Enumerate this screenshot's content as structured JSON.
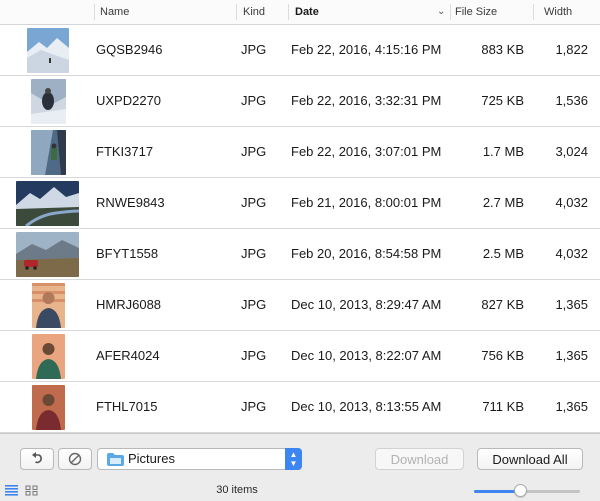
{
  "header": {
    "name": "Name",
    "kind": "Kind",
    "date": "Date",
    "file_size": "File Size",
    "width": "Width"
  },
  "rows": [
    {
      "name": "GQSB2946",
      "kind": "JPG",
      "date": "Feb 22, 2016, 4:15:16 PM",
      "size": "883 KB",
      "width": "1,822",
      "thumb": "snow-mountain"
    },
    {
      "name": "UXPD2270",
      "kind": "JPG",
      "date": "Feb 22, 2016, 3:32:31 PM",
      "size": "725 KB",
      "width": "1,536",
      "thumb": "ice-climber"
    },
    {
      "name": "FTKI3717",
      "kind": "JPG",
      "date": "Feb 22, 2016, 3:07:01 PM",
      "size": "1.7 MB",
      "width": "3,024",
      "thumb": "glacier-person"
    },
    {
      "name": "RNWE9843",
      "kind": "JPG",
      "date": "Feb 21, 2016, 8:00:01 PM",
      "size": "2.7 MB",
      "width": "4,032",
      "thumb": "mountain-lake"
    },
    {
      "name": "BFYT1558",
      "kind": "JPG",
      "date": "Feb 20, 2016, 8:54:58 PM",
      "size": "2.5 MB",
      "width": "4,032",
      "thumb": "car-landscape"
    },
    {
      "name": "HMRJ6088",
      "kind": "JPG",
      "date": "Dec 10, 2013, 8:29:47 AM",
      "size": "827 KB",
      "width": "1,365",
      "thumb": "portrait-man"
    },
    {
      "name": "AFER4024",
      "kind": "JPG",
      "date": "Dec 10, 2013, 8:22:07 AM",
      "size": "756 KB",
      "width": "1,365",
      "thumb": "portrait-man"
    },
    {
      "name": "FTHL7015",
      "kind": "JPG",
      "date": "Dec 10, 2013, 8:13:55 AM",
      "size": "711 KB",
      "width": "1,365",
      "thumb": "portrait-man"
    }
  ],
  "footer": {
    "location": "Pictures",
    "download": "Download",
    "download_all": "Download All",
    "item_count": "30 items",
    "thumbnail_size_fraction": 0.43
  },
  "colors": {
    "accent": "#3d86f2"
  }
}
